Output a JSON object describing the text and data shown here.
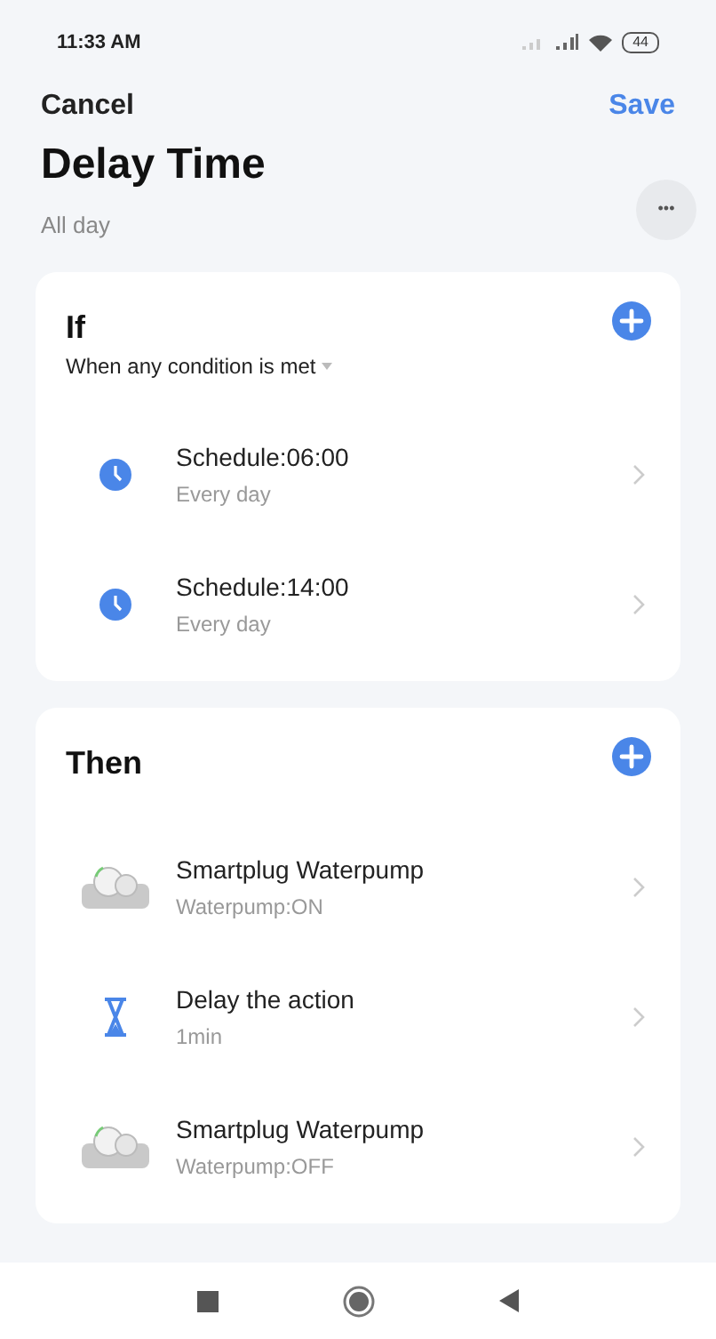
{
  "status_bar": {
    "time": "11:33 AM",
    "battery": "44"
  },
  "header": {
    "cancel": "Cancel",
    "save": "Save",
    "title": "Delay Time",
    "subtitle": "All day",
    "more": "•••"
  },
  "sections": [
    {
      "title": "If",
      "subtitle": "When any condition is met",
      "items": [
        {
          "kind": "clock",
          "title": "Schedule:06:00",
          "detail": "Every day"
        },
        {
          "kind": "clock",
          "title": "Schedule:14:00",
          "detail": "Every day"
        }
      ]
    },
    {
      "title": "Then",
      "items": [
        {
          "kind": "device",
          "title": "Smartplug Waterpump",
          "detail": "Waterpump:ON"
        },
        {
          "kind": "hourglass",
          "title": "Delay the action",
          "detail": "1min"
        },
        {
          "kind": "device",
          "title": "Smartplug Waterpump",
          "detail": "Waterpump:OFF"
        }
      ]
    }
  ]
}
